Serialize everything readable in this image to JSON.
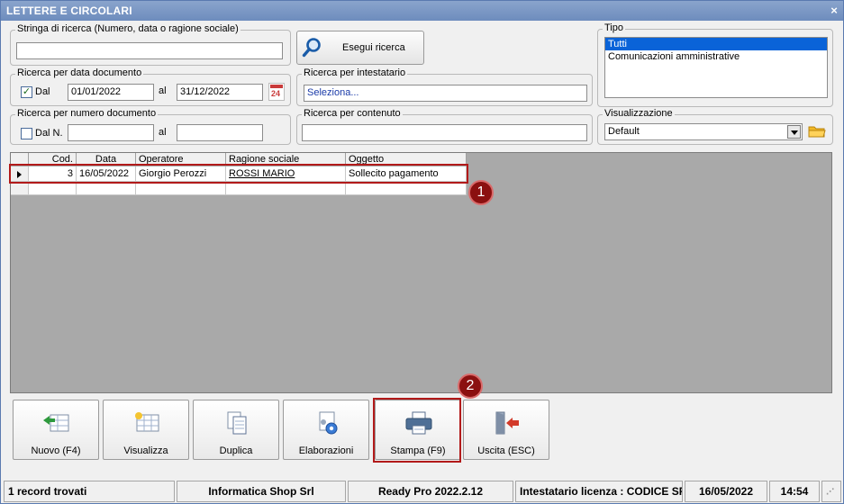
{
  "window": {
    "title": "LETTERE E CIRCOLARI",
    "close_glyph": "×"
  },
  "search": {
    "string_group_label": "Stringa di ricerca (Numero, data o ragione sociale)",
    "string_value": "",
    "button_label": "Esegui ricerca"
  },
  "date_search": {
    "group_label": "Ricerca per data documento",
    "dal_label": "Dal",
    "dal_checked": true,
    "from": "01/01/2022",
    "al_label": "al",
    "to": "31/12/2022",
    "calendar_text": "24"
  },
  "number_search": {
    "group_label": "Ricerca per numero documento",
    "dal_label": "Dal N.",
    "dal_checked": false,
    "from": "",
    "al_label": "al",
    "to": ""
  },
  "holder_search": {
    "group_label": "Ricerca per intestatario",
    "value": "Seleziona..."
  },
  "content_search": {
    "group_label": "Ricerca per contenuto",
    "value": ""
  },
  "tipo": {
    "group_label": "Tipo",
    "options": [
      "Tutti",
      "Comunicazioni amministrative"
    ],
    "selected": 0
  },
  "visualizzazione": {
    "group_label": "Visualizzazione",
    "value": "Default"
  },
  "grid": {
    "columns": [
      "Cod.",
      "Data",
      "Operatore",
      "Ragione sociale",
      "Oggetto"
    ],
    "rows": [
      {
        "cod": "3",
        "data": "16/05/2022",
        "operatore": "Giorgio Perozzi",
        "ragione": "ROSSI MARIO",
        "oggetto": "Sollecito pagamento"
      }
    ]
  },
  "callouts": [
    "1",
    "2"
  ],
  "toolbar": {
    "nuovo": "Nuovo (F4)",
    "visualizza": "Visualizza",
    "duplica": "Duplica",
    "elaborazioni": "Elaborazioni",
    "stampa": "Stampa (F9)",
    "uscita": "Uscita (ESC)"
  },
  "status": {
    "records": "1 record trovati",
    "company": "Informatica Shop Srl",
    "version": "Ready Pro 2022.2.12",
    "license": "Intestatario licenza : CODICE SRL",
    "date": "16/05/2022",
    "time": "14:54"
  },
  "colors": {
    "accent_red": "#b21a1a",
    "badge_red": "#8b1010",
    "selection_blue": "#0a63d8",
    "title_blue": "#6d8cbd"
  }
}
